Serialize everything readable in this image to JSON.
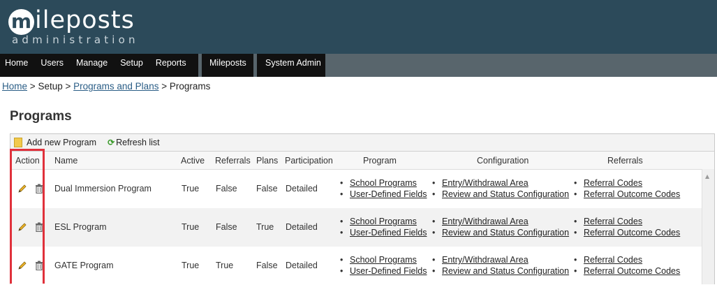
{
  "logo": {
    "initial": "m",
    "word": "ileposts",
    "sub": "administration"
  },
  "nav": {
    "group1": [
      "Home",
      "Users",
      "Manage",
      "Setup",
      "Reports"
    ],
    "group2": [
      "Mileposts"
    ],
    "group3": [
      "System Admin"
    ]
  },
  "breadcrumb": {
    "home": "Home",
    "sep": ">",
    "setup": "Setup",
    "programs_plans": "Programs and Plans",
    "current": "Programs"
  },
  "title": "Programs",
  "toolbar": {
    "add": "Add new Program",
    "refresh": "Refresh list"
  },
  "columns": [
    "Action",
    "Name",
    "Active",
    "Referrals",
    "Plans",
    "Participation",
    "Program",
    "Configuration",
    "Referrals"
  ],
  "rows": [
    {
      "name": "Dual Immersion Program",
      "active": "True",
      "referrals": "False",
      "plans": "False",
      "participation": "Detailed",
      "program_links": [
        "School Programs",
        "User-Defined Fields"
      ],
      "config_links": [
        "Entry/Withdrawal Area",
        "Review and Status Configuration"
      ],
      "referral_links": [
        "Referral Codes",
        "Referral Outcome Codes"
      ]
    },
    {
      "name": "ESL Program",
      "active": "True",
      "referrals": "False",
      "plans": "True",
      "participation": "Detailed",
      "program_links": [
        "School Programs",
        "User-Defined Fields"
      ],
      "config_links": [
        "Entry/Withdrawal Area",
        "Review and Status Configuration"
      ],
      "referral_links": [
        "Referral Codes",
        "Referral Outcome Codes"
      ]
    },
    {
      "name": "GATE Program",
      "active": "True",
      "referrals": "True",
      "plans": "False",
      "participation": "Detailed",
      "program_links": [
        "School Programs",
        "User-Defined Fields"
      ],
      "config_links": [
        "Entry/Withdrawal Area",
        "Review and Status Configuration"
      ],
      "referral_links": [
        "Referral Codes",
        "Referral Outcome Codes"
      ]
    }
  ],
  "colors": {
    "header": "#2c4a5a",
    "nav_bg": "#58656c",
    "nav_item_bg": "#111111",
    "link": "#2a5d86",
    "highlight": "#e0313b"
  },
  "icons": {
    "edit": "pencil-icon",
    "delete": "trash-icon",
    "add": "document-icon",
    "refresh": "refresh-icon"
  }
}
